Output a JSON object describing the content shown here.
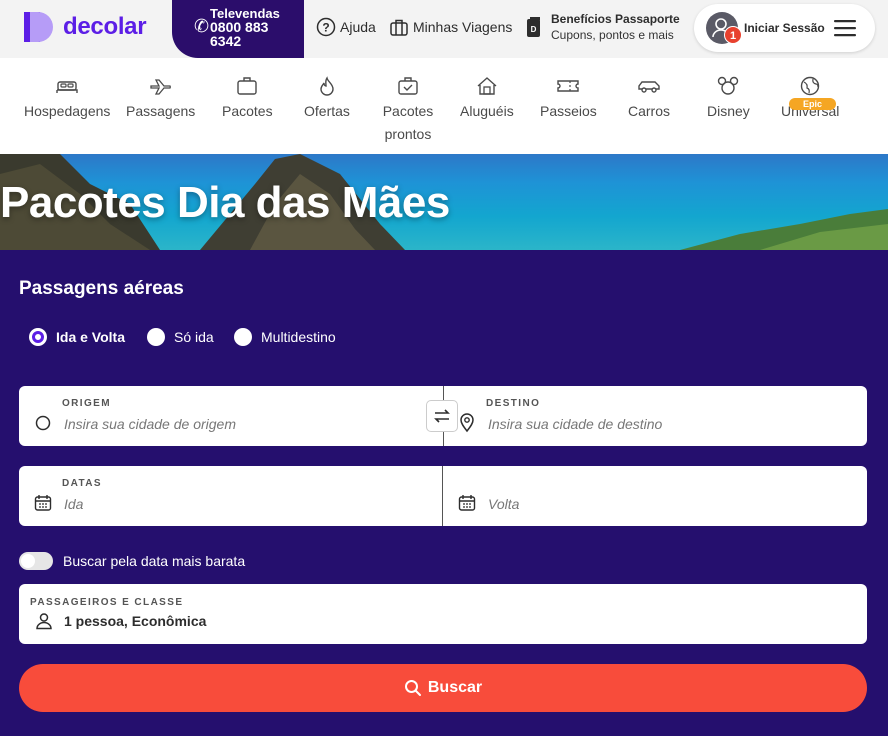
{
  "header": {
    "logo_text": "decolar",
    "televendas": {
      "title": "Televendas",
      "phone": "0800 883 6342"
    },
    "help_label": "Ajuda",
    "trips_label": "Minhas Viagens",
    "benefits": {
      "title": "Benefícios Passaporte",
      "subtitle": "Cupons, pontos e mais"
    },
    "login": {
      "label": "Iniciar Sessão",
      "notification_count": "1"
    }
  },
  "nav": {
    "items": [
      {
        "label": "Hospedagens",
        "icon": "bed-icon"
      },
      {
        "label": "Passagens",
        "icon": "plane-icon"
      },
      {
        "label": "Pacotes",
        "icon": "suitcase-icon"
      },
      {
        "label": "Ofertas",
        "icon": "flame-icon"
      },
      {
        "label": "Pacotes prontos",
        "icon": "luggage-check-icon"
      },
      {
        "label": "Aluguéis",
        "icon": "house-icon"
      },
      {
        "label": "Passeios",
        "icon": "ticket-icon"
      },
      {
        "label": "Carros",
        "icon": "car-icon"
      },
      {
        "label": "Disney",
        "icon": "mickey-icon"
      },
      {
        "label": "Universal",
        "icon": "globe-icon",
        "badge": "Epic"
      }
    ]
  },
  "hero": {
    "title": "Pacotes Dia das Mães"
  },
  "search": {
    "title": "Passagens aéreas",
    "trip_types": [
      {
        "label": "Ida e Volta",
        "selected": true
      },
      {
        "label": "Só ida",
        "selected": false
      },
      {
        "label": "Multidestino",
        "selected": false
      }
    ],
    "origin": {
      "label": "ORIGEM",
      "placeholder": "Insira sua cidade de origem"
    },
    "destination": {
      "label": "DESTINO",
      "placeholder": "Insira sua cidade de destino"
    },
    "dates": {
      "label": "DATAS",
      "departure_placeholder": "Ida",
      "return_placeholder": "Volta"
    },
    "cheapest_toggle": {
      "label": "Buscar pela data mais barata",
      "on": false
    },
    "passengers": {
      "label": "PASSAGEIROS E CLASSE",
      "value": "1 pessoa, Econômica"
    },
    "submit_label": "Buscar"
  },
  "colors": {
    "brand": "#5c1ee6",
    "search_bg": "#250f6e",
    "televendas_bg": "#2b0d6b",
    "cta": "#f84c3b",
    "badge_orange": "#f5a623"
  }
}
